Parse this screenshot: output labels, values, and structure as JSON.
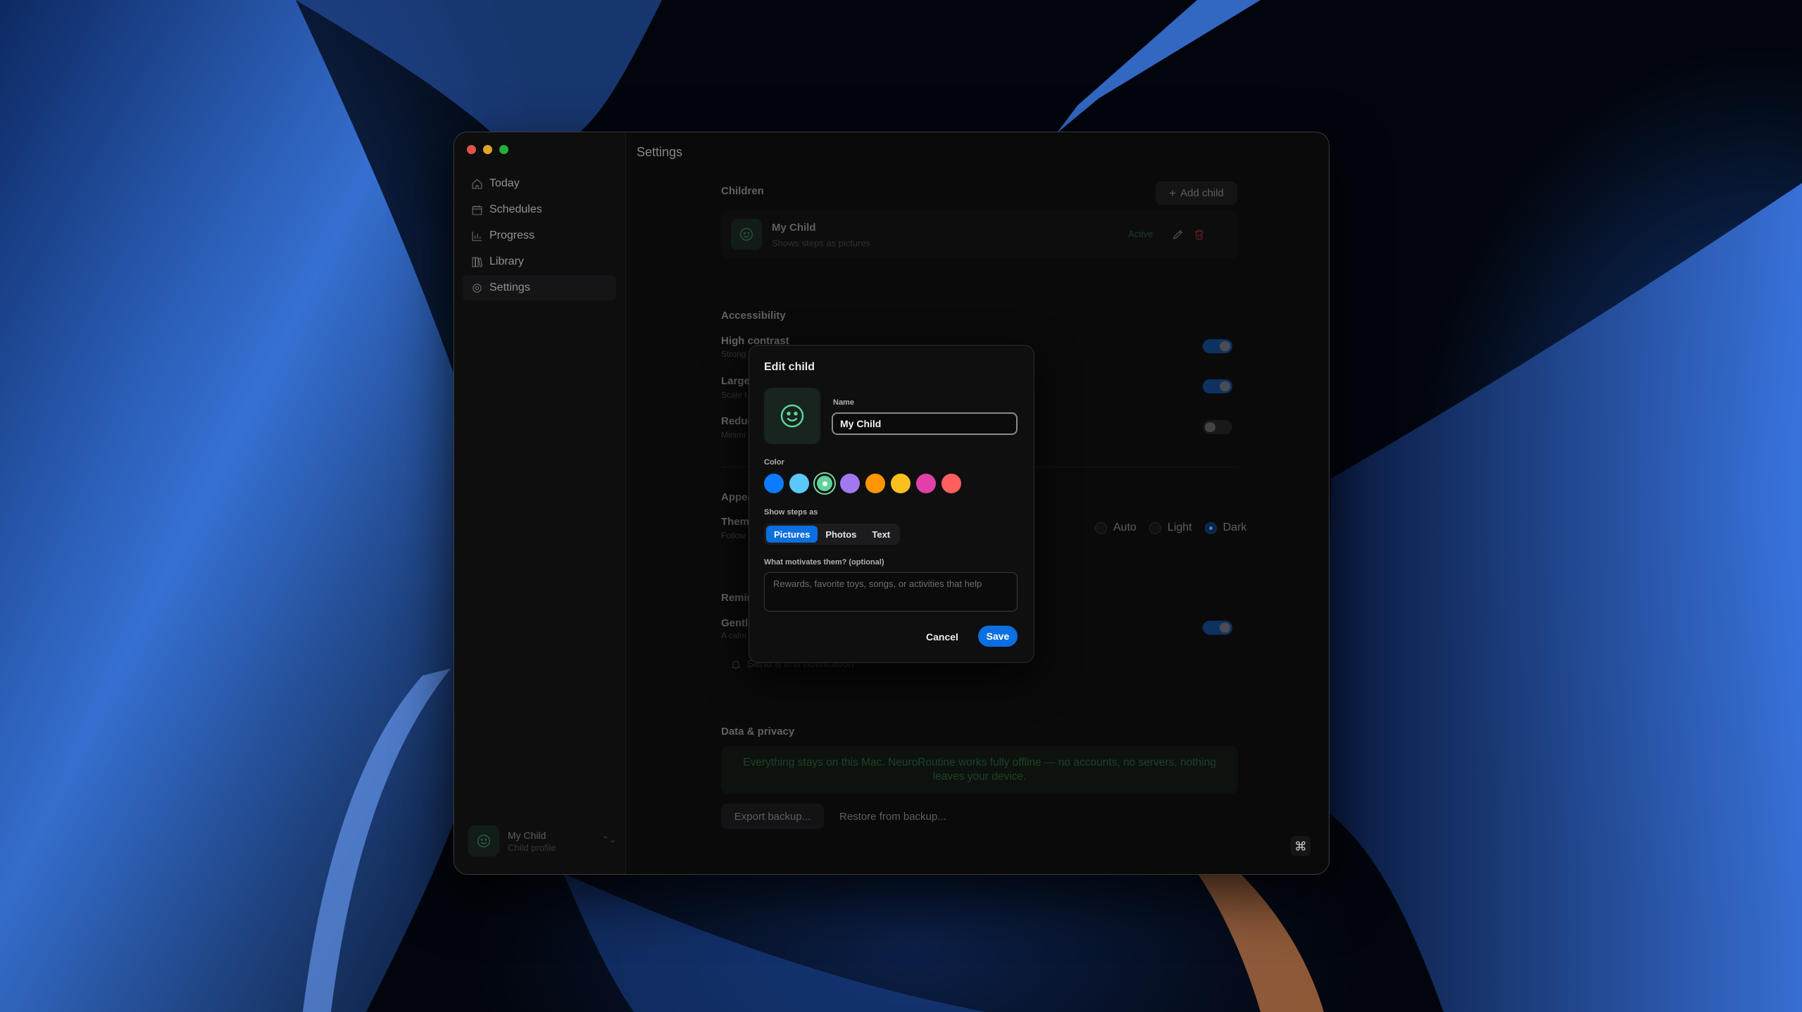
{
  "window": {
    "title": "Settings"
  },
  "sidebar": {
    "items": [
      {
        "label": "Today",
        "icon": "home-icon"
      },
      {
        "label": "Schedules",
        "icon": "calendar-icon"
      },
      {
        "label": "Progress",
        "icon": "bar-chart-icon"
      },
      {
        "label": "Library",
        "icon": "books-icon"
      },
      {
        "label": "Settings",
        "icon": "gear-icon",
        "active": true
      }
    ],
    "profile": {
      "name": "My Child",
      "subtitle": "Child profile"
    }
  },
  "children": {
    "section_title": "Children",
    "add_label": "Add child",
    "child": {
      "name": "My Child",
      "subtitle": "Shows steps as pictures",
      "badge": "Active"
    }
  },
  "accessibility": {
    "section_title": "Accessibility",
    "rows": [
      {
        "label": "High contrast",
        "sub": "Strong",
        "on": true
      },
      {
        "label": "Large",
        "sub": "Scale t",
        "on": true
      },
      {
        "label": "Reduc",
        "sub": "Minimi",
        "on": false
      }
    ]
  },
  "appearance": {
    "section_title": "Appea",
    "theme_label": "Them",
    "theme_sub": "Follow",
    "options": [
      "Auto",
      "Light",
      "Dark"
    ],
    "selected": "Dark"
  },
  "reminders": {
    "section_title": "Remin",
    "row_label": "Gentl",
    "row_sub": "A calm",
    "on": true,
    "test_label": "Send a test notification"
  },
  "privacy": {
    "section_title": "Data & privacy",
    "notice": "Everything stays on this Mac. NeuroRoutine works fully offline — no accounts, no servers, nothing leaves your device.",
    "export_label": "Export backup...",
    "restore_label": "Restore from backup..."
  },
  "modal": {
    "title": "Edit child",
    "name_label": "Name",
    "name_value": "My Child",
    "color_label": "Color",
    "colors": [
      "#0a7cff",
      "#5ac8fa",
      "#5fd39a",
      "#a178f0",
      "#ff9500",
      "#fcc01e",
      "#e040a8",
      "#ff5f5f"
    ],
    "selected_color": "#5fd39a",
    "steps_label": "Show steps as",
    "steps_options": [
      "Pictures",
      "Photos",
      "Text"
    ],
    "steps_selected": "Pictures",
    "motivation_label": "What motivates them? (optional)",
    "motivation_placeholder": "Rewards, favorite toys, songs, or activities that help",
    "motivation_value": "",
    "cancel_label": "Cancel",
    "save_label": "Save",
    "accent": "#0a6fe0"
  }
}
